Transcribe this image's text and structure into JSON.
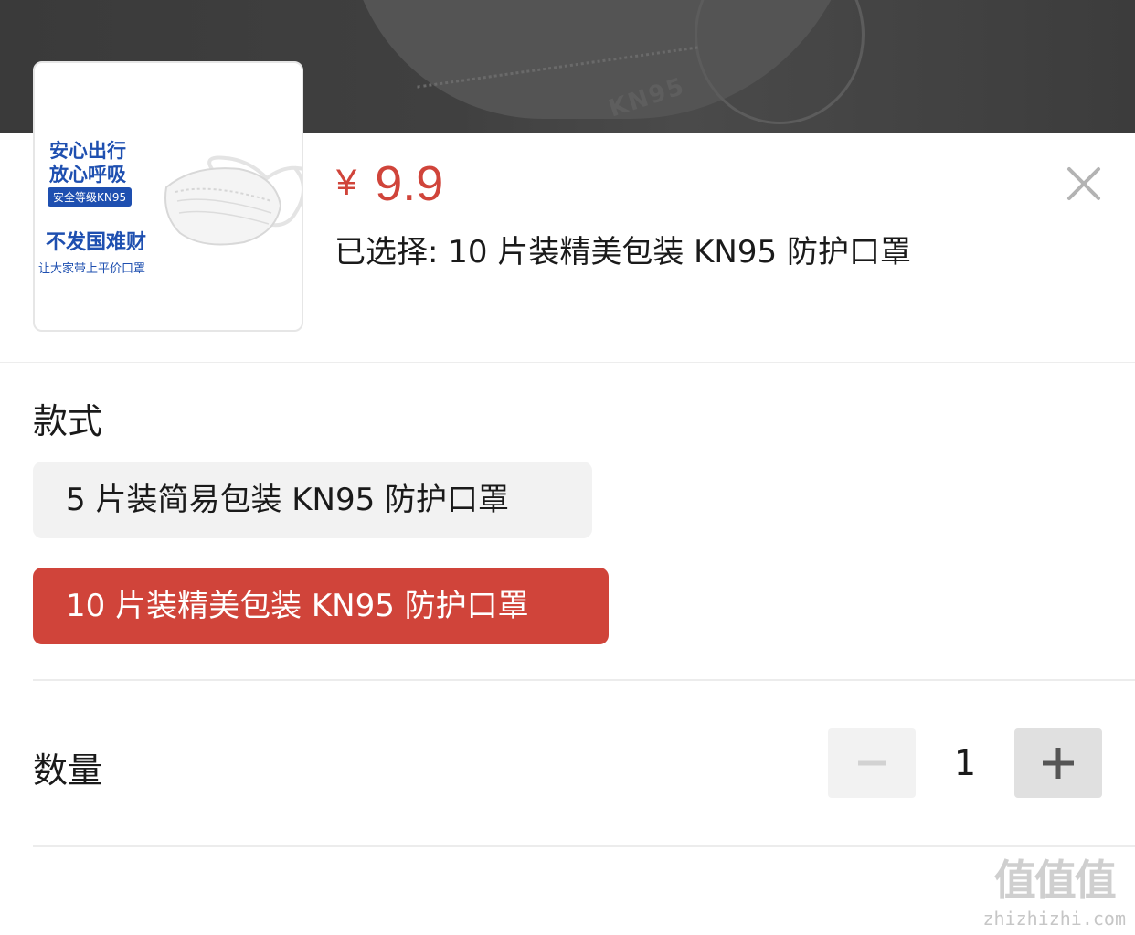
{
  "product": {
    "thumbnail": {
      "line1": "安心出行",
      "line2": "放心呼吸",
      "badge": "安全等级KN95",
      "line3": "不发国难财",
      "line4": "让大家带上平价口罩"
    },
    "backdrop_text": "KN95",
    "currency": "¥",
    "price": "9.9",
    "selected_text": "已选择: 10 片装精美包装 KN95 防护口罩"
  },
  "style_section": {
    "label": "款式",
    "options": [
      {
        "label": "5 片装简易包装 KN95 防护口罩",
        "selected": false
      },
      {
        "label": "10 片装精美包装 KN95 防护口罩",
        "selected": true
      }
    ]
  },
  "quantity_section": {
    "label": "数量",
    "value": "1"
  },
  "colors": {
    "accent": "#d0443a",
    "option_bg": "#f2f2f2"
  },
  "watermark": {
    "cn": "值值值",
    "en": "zhizhizhi.com"
  }
}
